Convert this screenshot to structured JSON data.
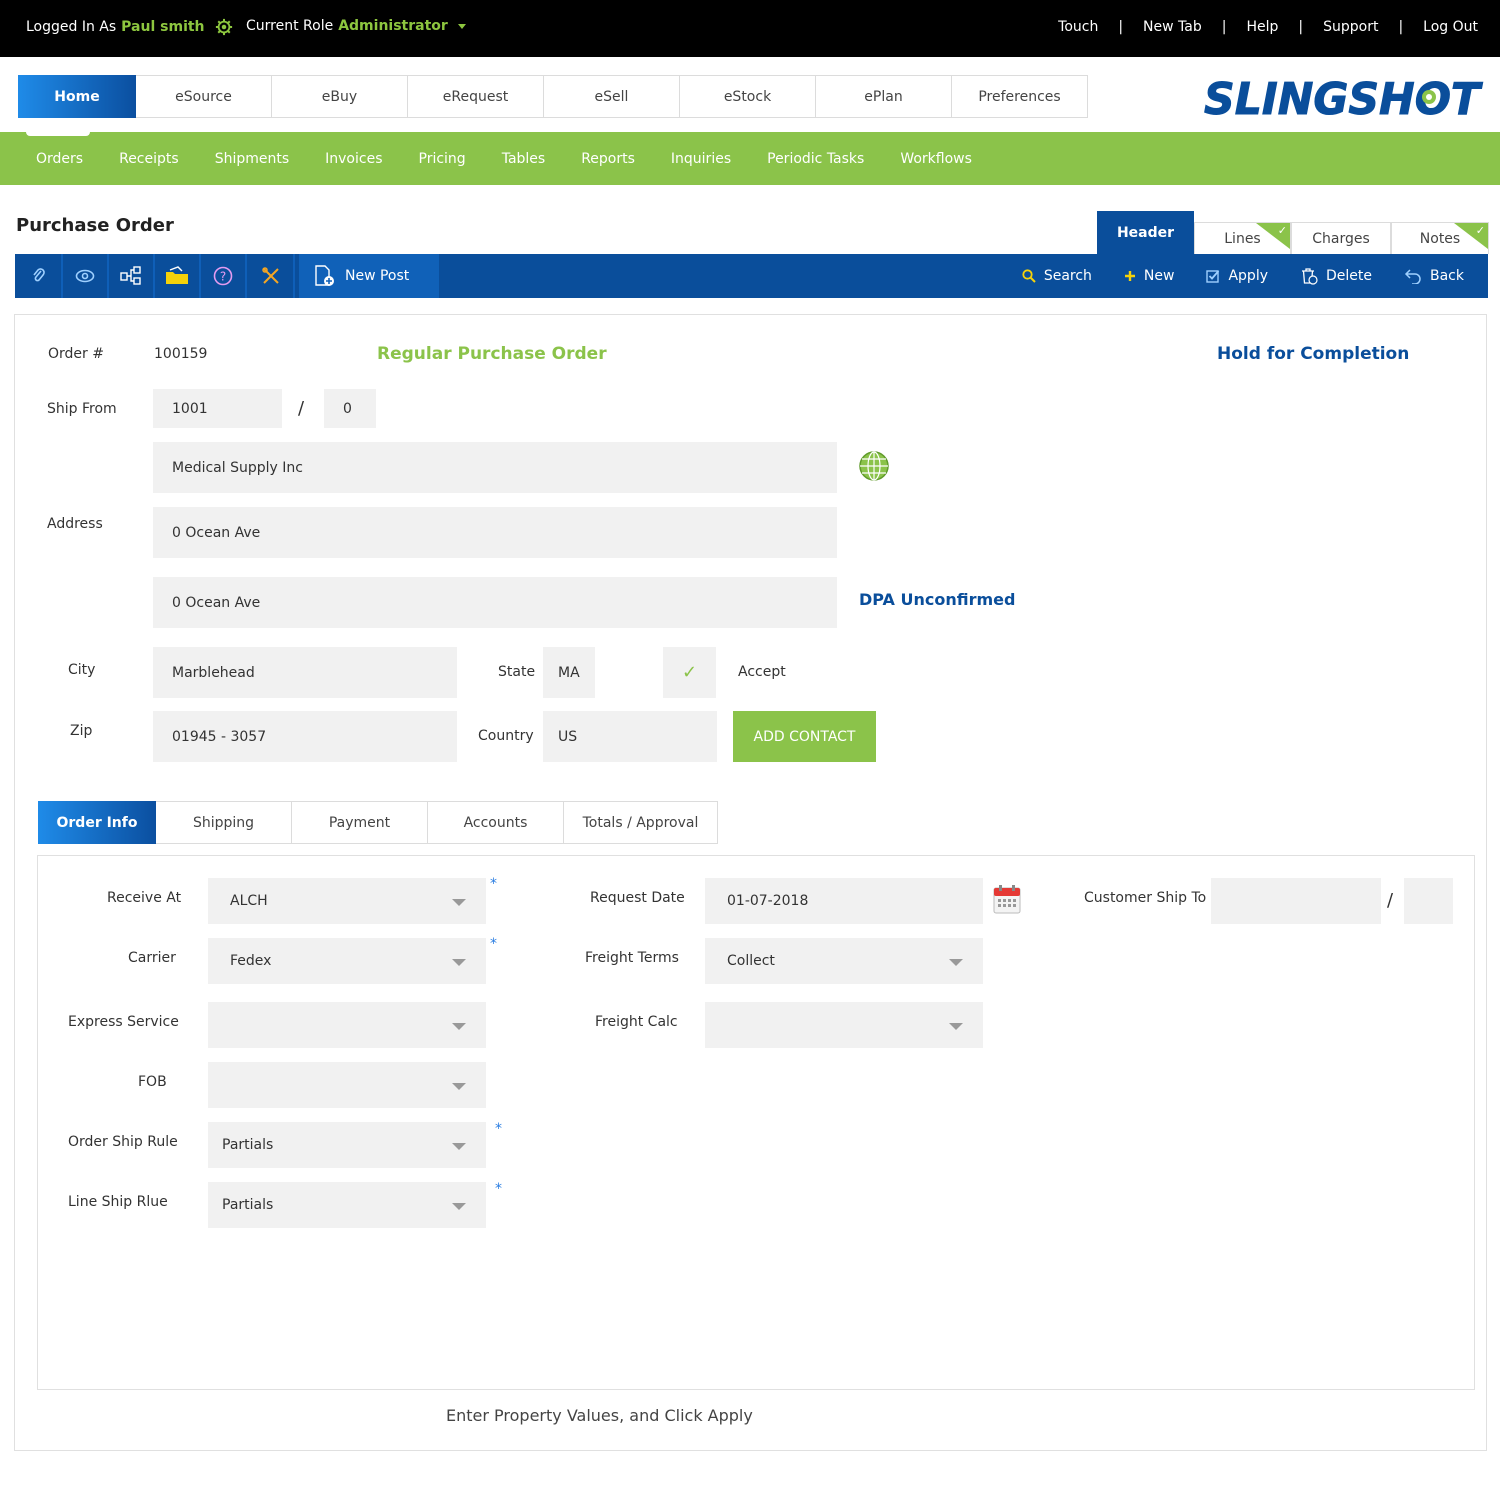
{
  "topbar": {
    "logged_in_prefix": "Logged In As",
    "user_name": "Paul smith",
    "role_prefix": "Current Role",
    "role_name": "Administrator",
    "links": [
      "Touch",
      "New Tab",
      "Help",
      "Support",
      "Log Out"
    ],
    "separator": "|"
  },
  "modules": [
    "Home",
    "eSource",
    "eBuy",
    "eRequest",
    "eSell",
    "eStock",
    "ePlan",
    "Preferences"
  ],
  "logo_text": "SLINGSHOT",
  "nav": [
    "Orders",
    "Receipts",
    "Shipments",
    "Invoices",
    "Pricing",
    "Tables",
    "Reports",
    "Inquiries",
    "Periodic Tasks",
    "Workflows"
  ],
  "page_title": "Purchase Order",
  "right_tabs": [
    {
      "label": "Header",
      "checked": false
    },
    {
      "label": "Lines",
      "checked": true
    },
    {
      "label": "Charges",
      "checked": false
    },
    {
      "label": "Notes",
      "checked": true
    }
  ],
  "toolbar": {
    "icons": [
      "attach-icon",
      "view-icon",
      "hierarchy-icon",
      "folder-icon",
      "help-icon",
      "tools-icon"
    ],
    "new_post": "New Post",
    "actions": {
      "search": "Search",
      "new": "New",
      "apply": "Apply",
      "delete": "Delete",
      "back": "Back"
    }
  },
  "order": {
    "order_label": "Order #",
    "order_number": "100159",
    "order_type": "Regular Purchase Order",
    "status": "Hold for Completion",
    "ship_from_label": "Ship From",
    "ship_from_id": "1001",
    "ship_from_sep": "/",
    "ship_from_suffix": "0",
    "address_label": "Address",
    "address_name": "Medical Supply Inc",
    "address_line1": "0 Ocean Ave",
    "address_line2": "0 Ocean Ave",
    "dpa_status": "DPA Unconfirmed",
    "city_label": "City",
    "city": "Marblehead",
    "state_label": "State",
    "state": "MA",
    "accept_label": "Accept",
    "zip_label": "Zip",
    "zip": "01945 - 3057",
    "country_label": "Country",
    "country": "US",
    "add_contact": "ADD CONTACT"
  },
  "sub_tabs": [
    "Order Info",
    "Shipping",
    "Payment",
    "Accounts",
    "Totals / Approval"
  ],
  "order_info": {
    "receive_at_label": "Receive At",
    "receive_at": "ALCH",
    "carrier_label": "Carrier",
    "carrier": "Fedex",
    "express_label": "Express Service",
    "express": "",
    "fob_label": "FOB",
    "fob": "",
    "order_ship_rule_label": "Order Ship Rule",
    "order_ship_rule": "Partials",
    "line_ship_rule_label": "Line Ship Rlue",
    "line_ship_rule": "Partials",
    "request_date_label": "Request Date",
    "request_date": "01-07-2018",
    "freight_terms_label": "Freight Terms",
    "freight_terms": "Collect",
    "freight_calc_label": "Freight Calc",
    "freight_calc": "",
    "customer_ship_to_label": "Customer Ship To",
    "customer_ship_to": "",
    "customer_ship_to_sep": "/",
    "customer_ship_to_suffix": "",
    "required_mark": "*"
  },
  "footer_message": "Enter Property Values, and Click Apply",
  "colors": {
    "accent_green": "#8bc34a",
    "brand_blue": "#0a4e9b",
    "topbar": "#000000"
  }
}
